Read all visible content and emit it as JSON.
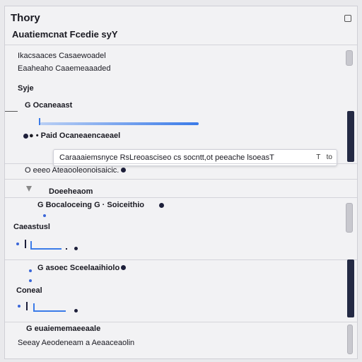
{
  "window": {
    "title": "Thory",
    "subtitle": "Auatiemcnat Fcedie syY"
  },
  "section1": {
    "line1": "Ikacsaaces Casaewoadel",
    "line2": "Eaaheaho Caaemeaaaded"
  },
  "section2": {
    "heading": "Syje",
    "group_label": "G Ocaneaast",
    "dropdown_label": "● • Paid Ocaneaencaeael ",
    "tooltip_text": "Caraaaiemsnyce RsLreoasciseo cs socntt,ot peeache lsoeasT",
    "tooltip_shortcut_a": "T",
    "tooltip_shortcut_b": "to"
  },
  "section3": {
    "line1": "O eeeo Ateaooleonoisaicic."
  },
  "section4": {
    "heading": "Doeeheaom",
    "row": "G  Bocaloceing  G  · Soiceithio"
  },
  "section5": {
    "heading": "Caeastusl"
  },
  "section6": {
    "row": "G  asoec Sceelaaihiolo"
  },
  "section7": {
    "heading": "Coneal"
  },
  "section8": {
    "heading": "G euaiememaeeaale",
    "subline": "Seeay Aeodeneam a Aeaaceaolin"
  },
  "colors": {
    "accent": "#3b7be8",
    "sidebar_dark": "#242a44",
    "background": "#f2f2f4"
  }
}
